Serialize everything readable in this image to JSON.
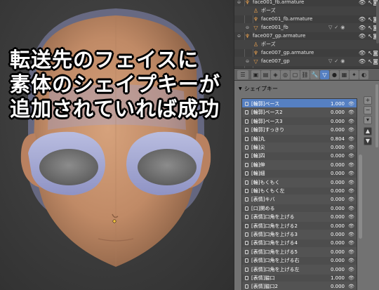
{
  "caption": {
    "line1": "転送先のフェイスに",
    "line2": "素体のシェイプキーが",
    "line3": "追加されていれば成功"
  },
  "outliner": {
    "rows": [
      {
        "name": "face001_fb.armature",
        "icon": "armature-icon",
        "indent": 1
      },
      {
        "name": "ポーズ",
        "icon": "pose-icon",
        "indent": 2
      },
      {
        "name": "face001_fb.armature",
        "icon": "armature-data-icon",
        "indent": 2
      },
      {
        "name": "face001_fb",
        "icon": "mesh-icon",
        "indent": 2
      },
      {
        "name": "face007_gp.armature",
        "icon": "armature-icon",
        "indent": 1
      },
      {
        "name": "ポーズ",
        "icon": "pose-icon",
        "indent": 2
      },
      {
        "name": "face007_gp.armature",
        "icon": "armature-data-icon",
        "indent": 2
      },
      {
        "name": "face007_gp",
        "icon": "mesh-icon",
        "indent": 2
      }
    ]
  },
  "properties": {
    "panel_title": "シェイプキー",
    "active_tab_icon": "object-data-icon",
    "accent_color": "#5680c2",
    "shape_keys": [
      {
        "name": "[輪郭]ベース",
        "value": "1.000"
      },
      {
        "name": "[輪郭]ベース2",
        "value": "0.000"
      },
      {
        "name": "[輪郭]ベース3",
        "value": "0.000"
      },
      {
        "name": "[輪郭]すっきり",
        "value": "0.000"
      },
      {
        "name": "[輪]丸",
        "value": "0.804"
      },
      {
        "name": "[輪]尖",
        "value": "0.000"
      },
      {
        "name": "[輪]四",
        "value": "0.000"
      },
      {
        "name": "[輪]伸",
        "value": "0.000"
      },
      {
        "name": "[輪]細",
        "value": "0.000"
      },
      {
        "name": "[輪]もくもく",
        "value": "0.000"
      },
      {
        "name": "[輪]もくもく左",
        "value": "0.000"
      },
      {
        "name": "[表情]キバ",
        "value": "0.000"
      },
      {
        "name": "[口]開める",
        "value": "0.000"
      },
      {
        "name": "[表情]口角を上げる",
        "value": "0.000"
      },
      {
        "name": "[表情]口角を上げる2",
        "value": "0.000"
      },
      {
        "name": "[表情]口角を上げる3",
        "value": "0.000"
      },
      {
        "name": "[表情]口角を上げる4",
        "value": "0.000"
      },
      {
        "name": "[表情]口角を上げる5",
        "value": "0.000"
      },
      {
        "name": "[表情]口角を上げる右",
        "value": "0.000"
      },
      {
        "name": "[表情]口角を上げる左",
        "value": "0.000"
      },
      {
        "name": "[表情]脇口",
        "value": "1.000"
      },
      {
        "name": "[表情]脇口2",
        "value": "0.000"
      }
    ]
  }
}
